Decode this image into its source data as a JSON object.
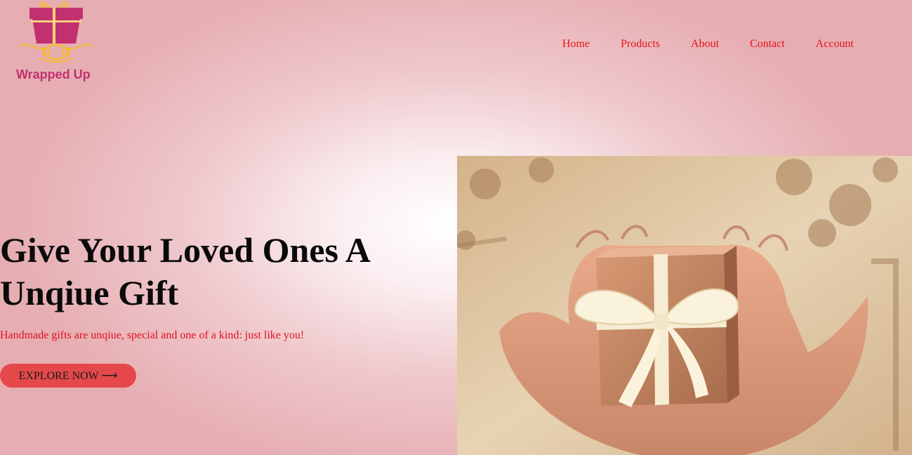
{
  "brand": {
    "name": "Wrapped Up",
    "primary_color": "#c2306f",
    "accent_color": "#f2b843"
  },
  "nav": {
    "items": [
      "Home",
      "Products",
      "About",
      "Contact",
      "Account"
    ],
    "link_color": "#e8101a"
  },
  "hero": {
    "title": "Give Your Loved Ones A Unqiue Gift",
    "subtitle": "Handmade gifts are unqiue, special and one of a kind: just like you!",
    "cta_label": "EXPLORE NOW ⟶",
    "cta_color": "#e5484b"
  }
}
